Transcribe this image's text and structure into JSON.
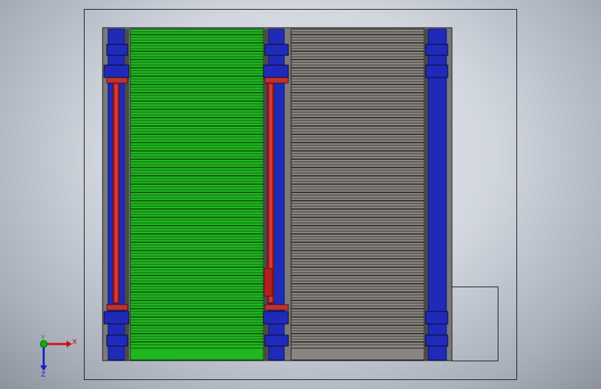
{
  "scene": {
    "background_top": "#e2e6ec",
    "background_edge": "#8c939e",
    "outline_color": "#1a1a1a"
  },
  "colors": {
    "frame_blue": "#1f2ab8",
    "frame_blue_dark": "#0b1170",
    "cylinder_red": "#b02020",
    "cylinder_red_light": "#d84040",
    "roller_green": "#1fb81f",
    "roller_green_gap": "#0d3d0d",
    "roller_gray": "#8a8580",
    "roller_gray_gap": "#1e1e1e",
    "rail_gray": "#6f6f6f"
  },
  "triad": {
    "x_label": "X",
    "y_label": "Y",
    "z_label": "Z",
    "x_color": "#cc1111",
    "y_color": "#11aa11",
    "z_color": "#1122cc"
  }
}
